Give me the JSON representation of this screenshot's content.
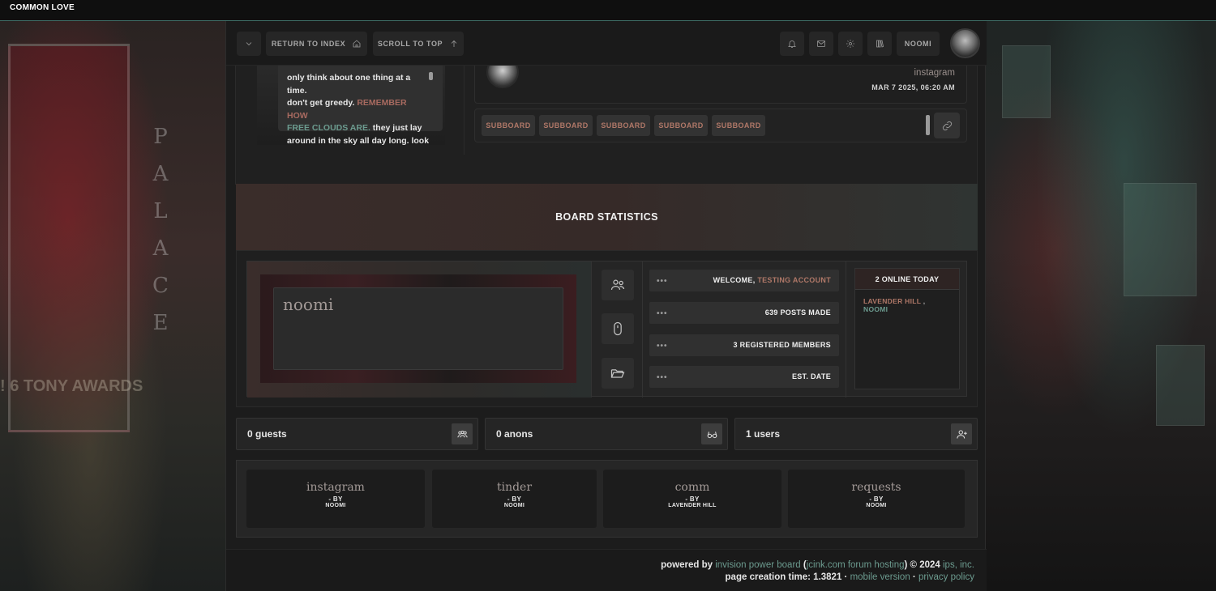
{
  "site": {
    "title": "COMMON LOVE"
  },
  "nav": {
    "return_label": "RETURN TO INDEX",
    "scroll_label": "SCROLL TO TOP",
    "user_label": "NOOMI"
  },
  "post": {
    "quote_line1": "only think about one thing at a time.",
    "quote_line2a": "don't get greedy.",
    "quote_line2b": "REMEMBER HOW",
    "quote_line3a": "FREE CLOUDS ARE.",
    "quote_line3b": "they just lay",
    "quote_line4": "around in the sky all day long. look",
    "forum_name": "instagram",
    "date": "MAR 7 2025, 06:20 AM",
    "subboards": [
      "SUBBOARD",
      "SUBBOARD",
      "SUBBOARD",
      "SUBBOARD",
      "SUBBOARD"
    ]
  },
  "stats": {
    "title": "BOARD STATISTICS",
    "banner_name": "noomi",
    "welcome_prefix": "WELCOME,",
    "welcome_user": "TESTING ACCOUNT",
    "posts_made": "639 POSTS MADE",
    "registered": "3 REGISTERED MEMBERS",
    "est_date": "EST. DATE",
    "dots": "•••",
    "online_title": "2 ONLINE TODAY",
    "online_user1": "LAVENDER HILL",
    "online_sep": ",",
    "online_user2": "NOOMI"
  },
  "counters": {
    "guests": "0 guests",
    "anons": "0 anons",
    "users": "1 users"
  },
  "affiliates": [
    {
      "name": "instagram",
      "by": "- BY",
      "who": "NOOMI"
    },
    {
      "name": "tinder",
      "by": "- BY",
      "who": "NOOMI"
    },
    {
      "name": "comm",
      "by": "- BY",
      "who": "LAVENDER HILL"
    },
    {
      "name": "requests",
      "by": "- BY",
      "who": "NOOMI"
    }
  ],
  "footer": {
    "powered_by": "powered by",
    "ipb": "invision power board",
    "open_paren": " (",
    "jcink": "jcink.com forum hosting",
    "close_copy": ") © 2024 ",
    "ips": "ips, inc.",
    "creation": "page creation time: 1.3821 · ",
    "mobile": "mobile version",
    "dot": " · ",
    "privacy": "privacy policy"
  },
  "background": {
    "palace_letters": [
      "P",
      "A",
      "L",
      "A",
      "C",
      "E"
    ],
    "poster_text": "! 6 TONY AWARDS"
  },
  "colors": {
    "accent_red": "#b07868",
    "accent_green": "#6c9b8f",
    "topbar_border": "#3d6b64"
  }
}
